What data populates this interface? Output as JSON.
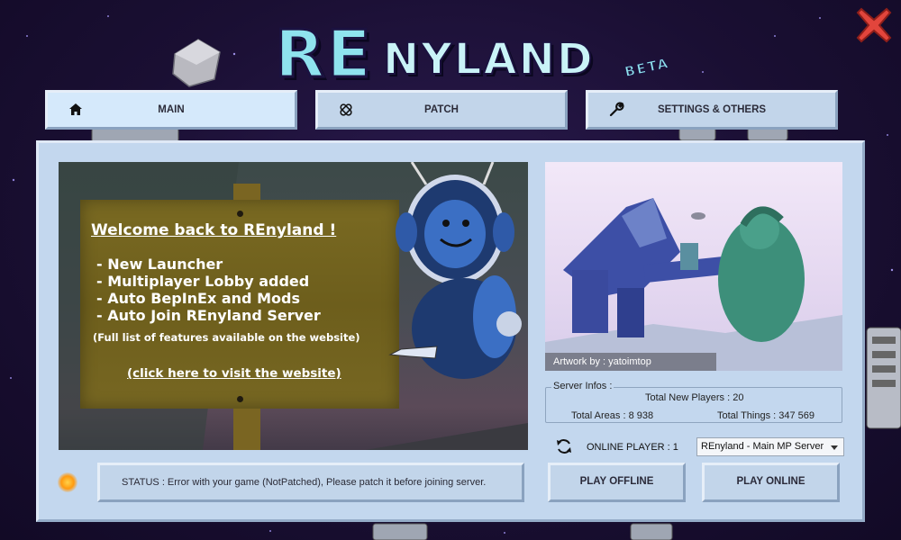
{
  "app": {
    "logo_text": "RENYLAND",
    "logo_badge": "BETA"
  },
  "tabs": [
    {
      "label": "MAIN",
      "icon": "home-icon",
      "active": true
    },
    {
      "label": "PATCH",
      "icon": "bandage-icon",
      "active": false
    },
    {
      "label": "SETTINGS & OTHERS",
      "icon": "wrench-icon",
      "active": false
    }
  ],
  "news": {
    "title": "Welcome back to REnyland !",
    "features": [
      "- New Launcher",
      "- Multiplayer Lobby added",
      "- Auto BepInEx and Mods",
      "- Auto Join REnyland Server"
    ],
    "note": "(Full list of features available on the website)",
    "link": "(click here to visit the website)"
  },
  "artwork": {
    "credit": "Artwork by : yatoimtop"
  },
  "server_info": {
    "legend": "Server Infos :",
    "new_players": "Total New Players : 20",
    "areas": "Total Areas : 8 938",
    "things": "Total Things : 347 569"
  },
  "online": {
    "label": "ONLINE PLAYER : 1",
    "selected_server": "REnyland - Main MP Server"
  },
  "buttons": {
    "play_offline": "PLAY OFFLINE",
    "play_online": "PLAY ONLINE"
  },
  "status": {
    "text": "STATUS : Error with your game (NotPatched), Please patch it before joining server.",
    "light_color": "#ffa21a"
  },
  "colors": {
    "background": "#1a0f33",
    "panel": "#c3d7ee",
    "active_tab": "#d5e9fb",
    "close": "#e2453c"
  }
}
